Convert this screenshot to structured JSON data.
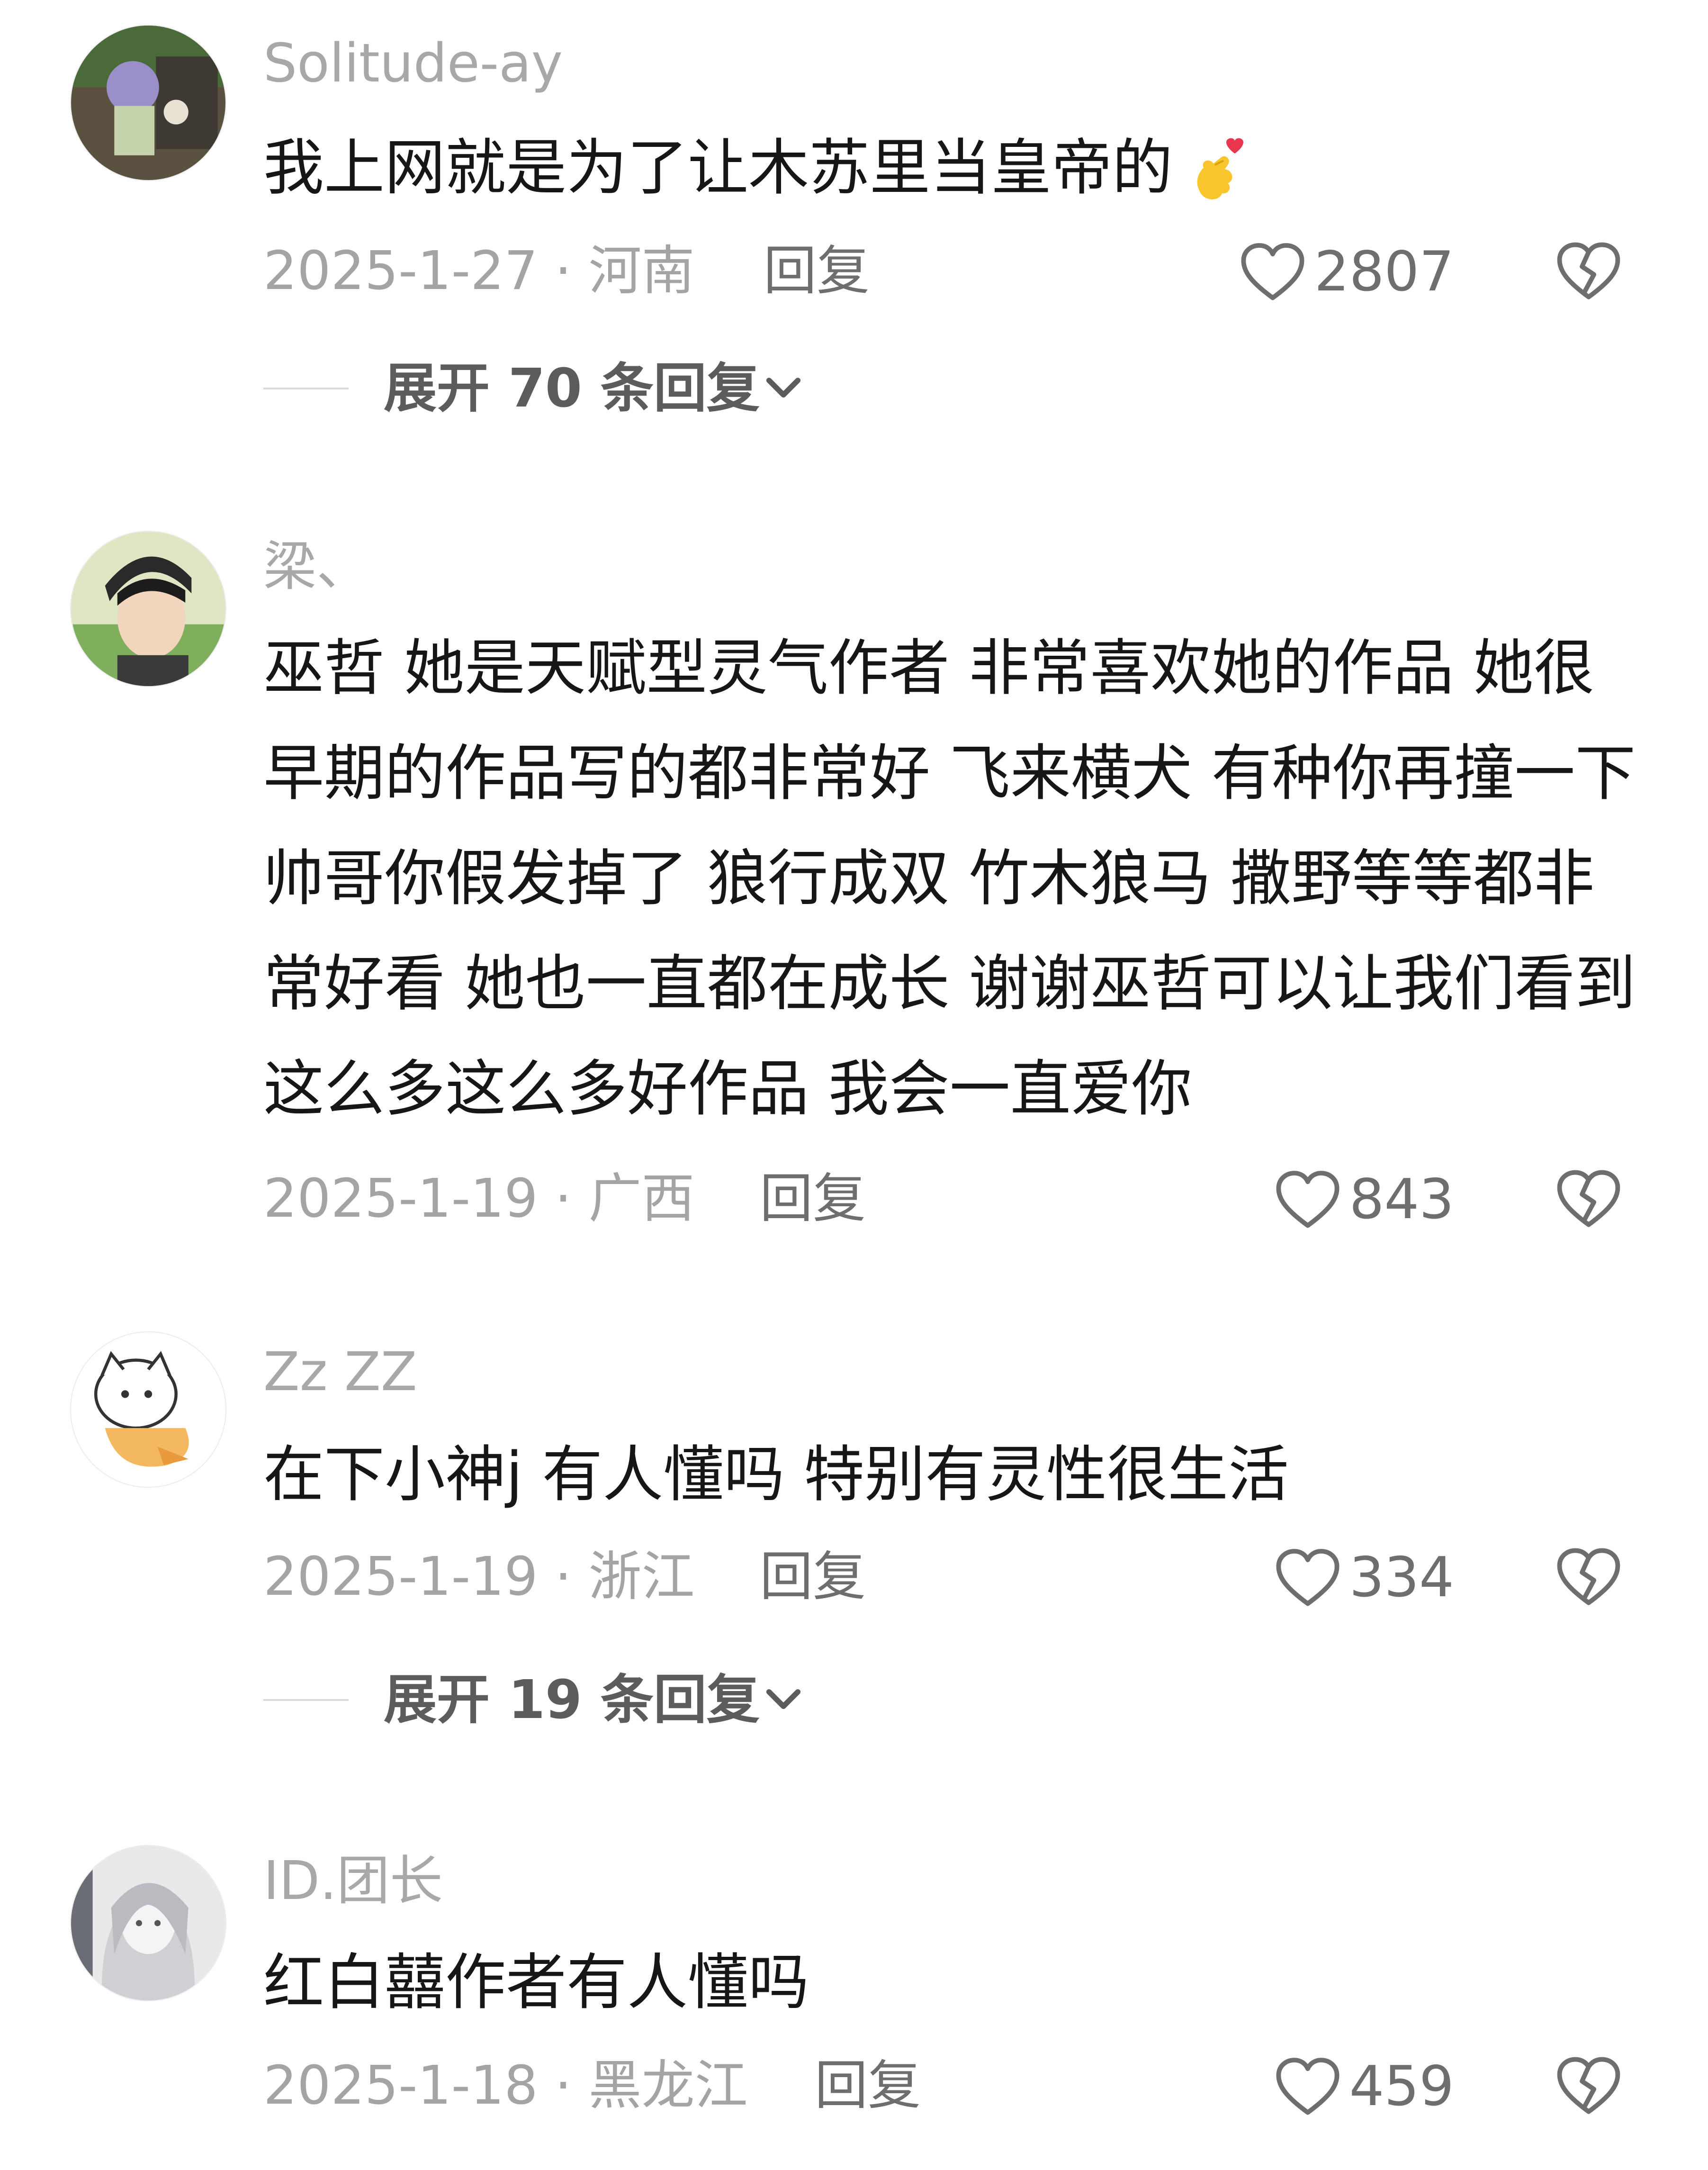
{
  "comments": [
    {
      "username": "Solitude-ay",
      "text": "我上网就是为了让木苏里当皇帝的",
      "emoji": "finger-heart-emoji",
      "date_location": "2025-1-27 · 河南",
      "reply_label": "回复",
      "likes": "2807",
      "expand_label": "展开 70 条回复"
    },
    {
      "username": "梁、",
      "text": "巫哲 她是天赋型灵气作者 非常喜欢她的作品 她很早期的作品写的都非常好 飞来横犬 有种你再撞一下 帅哥你假发掉了 狼行成双 竹木狼马 撒野等等都非常好看 她也一直都在成长 谢谢巫哲可以让我们看到这么多这么多好作品 我会一直爱你",
      "date_location": "2025-1-19 · 广西",
      "reply_label": "回复",
      "likes": "843"
    },
    {
      "username": "Zz ZZ",
      "text": "在下小神j  有人懂吗  特别有灵性很生活",
      "date_location": "2025-1-19 · 浙江",
      "reply_label": "回复",
      "likes": "334",
      "expand_label": "展开 19 条回复"
    },
    {
      "username": "ID.团长",
      "text": "红白囍作者有人懂吗",
      "date_location": "2025-1-18 · 黑龙江",
      "reply_label": "回复",
      "likes": "459"
    }
  ],
  "icons": {
    "like": "heart-outline-icon",
    "dislike": "broken-heart-icon",
    "expand": "chevron-down-icon"
  },
  "colors": {
    "username": "#a8a8a8",
    "text": "#161616",
    "meta": "#a4a4a4",
    "action": "#6e6e6e"
  }
}
